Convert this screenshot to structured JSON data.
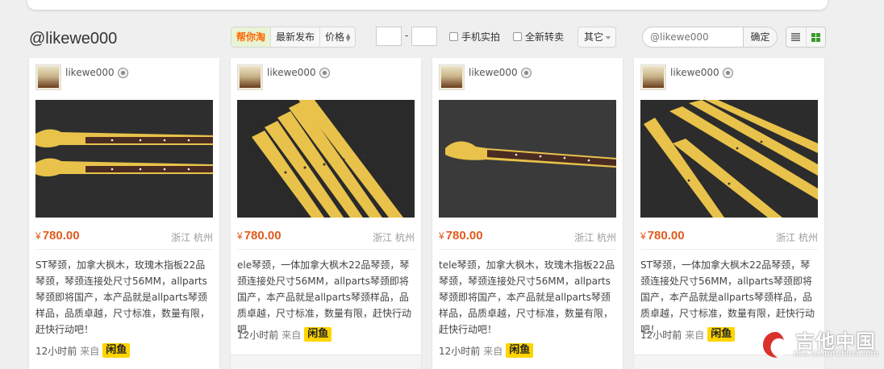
{
  "page": {
    "title": "@likewe000"
  },
  "toolbar": {
    "sort_tabs": [
      {
        "label": "帮你淘",
        "active": true
      },
      {
        "label": "最新发布",
        "active": false
      },
      {
        "label": "价格",
        "active": false
      }
    ],
    "price_min": "",
    "price_max": "",
    "dash": "-",
    "checkbox_phone_photo": "手机实拍",
    "checkbox_brand_new": "全新转卖",
    "other_label": "其它",
    "search_placeholder": "@likewe000",
    "search_button": "确定",
    "views": [
      {
        "icon": "list-view-icon",
        "active": false
      },
      {
        "icon": "grid-view-icon",
        "active": true
      }
    ]
  },
  "cards": [
    {
      "username": "likewe000",
      "currency": "¥",
      "price": "780.00",
      "location": "浙江 杭州",
      "description": "ST琴颈，加拿大枫木，玫瑰木指板22品琴颈，琴颈连接处尺寸56MM，allparts琴颈即将国产，本产品就是allparts琴颈样品，品质卓越，尺寸标准，数量有限，赶快行动吧！",
      "time": "12小时前",
      "from": "来自",
      "source": "闲鱼",
      "image": "two-necks-rosewood"
    },
    {
      "username": "likewe000",
      "currency": "¥",
      "price": "780.00",
      "location": "浙江 杭州",
      "description": "ele琴颈，一体加拿大枫木22品琴颈，琴颈连接处尺寸56MM，allparts琴颈即将国产，本产品就是allparts琴颈样品，品质卓越，尺寸标准，数量有限，赶快行动吧",
      "time": "12小时前",
      "from": "来自",
      "source": "闲鱼",
      "image": "five-necks-maple"
    },
    {
      "username": "likewe000",
      "currency": "¥",
      "price": "780.00",
      "location": "浙江 杭州",
      "description": "tele琴颈，加拿大枫木，玫瑰木指板22品琴颈，琴颈连接处尺寸56MM，allparts琴颈即将国产，本产品就是allparts琴颈样品，品质卓越，尺寸标准，数量有限，赶快行动吧！",
      "time": "12小时前",
      "from": "来自",
      "source": "闲鱼",
      "image": "one-neck-rosewood"
    },
    {
      "username": "likewe000",
      "currency": "¥",
      "price": "780.00",
      "location": "浙江 杭州",
      "description": "ST琴颈，一体加拿大枫木22品琴颈，琴颈连接处尺寸56MM，allparts琴颈即将国产，本产品就是allparts琴颈样品，品质卓越，尺寸标准，数量有限，赶快行动吧！",
      "time": "12小时前",
      "from": "来自",
      "source": "闲鱼",
      "image": "five-necks-maple-2"
    }
  ],
  "watermark": {
    "text": "吉他中国",
    "url": "bbs.GuitarChina.com"
  },
  "colors": {
    "price": "#e05a1e",
    "active_tab": "#ff6600",
    "xianyu_badge": "#ffd400",
    "maple": "#e8c24a",
    "rosewood": "#4a2c22"
  }
}
